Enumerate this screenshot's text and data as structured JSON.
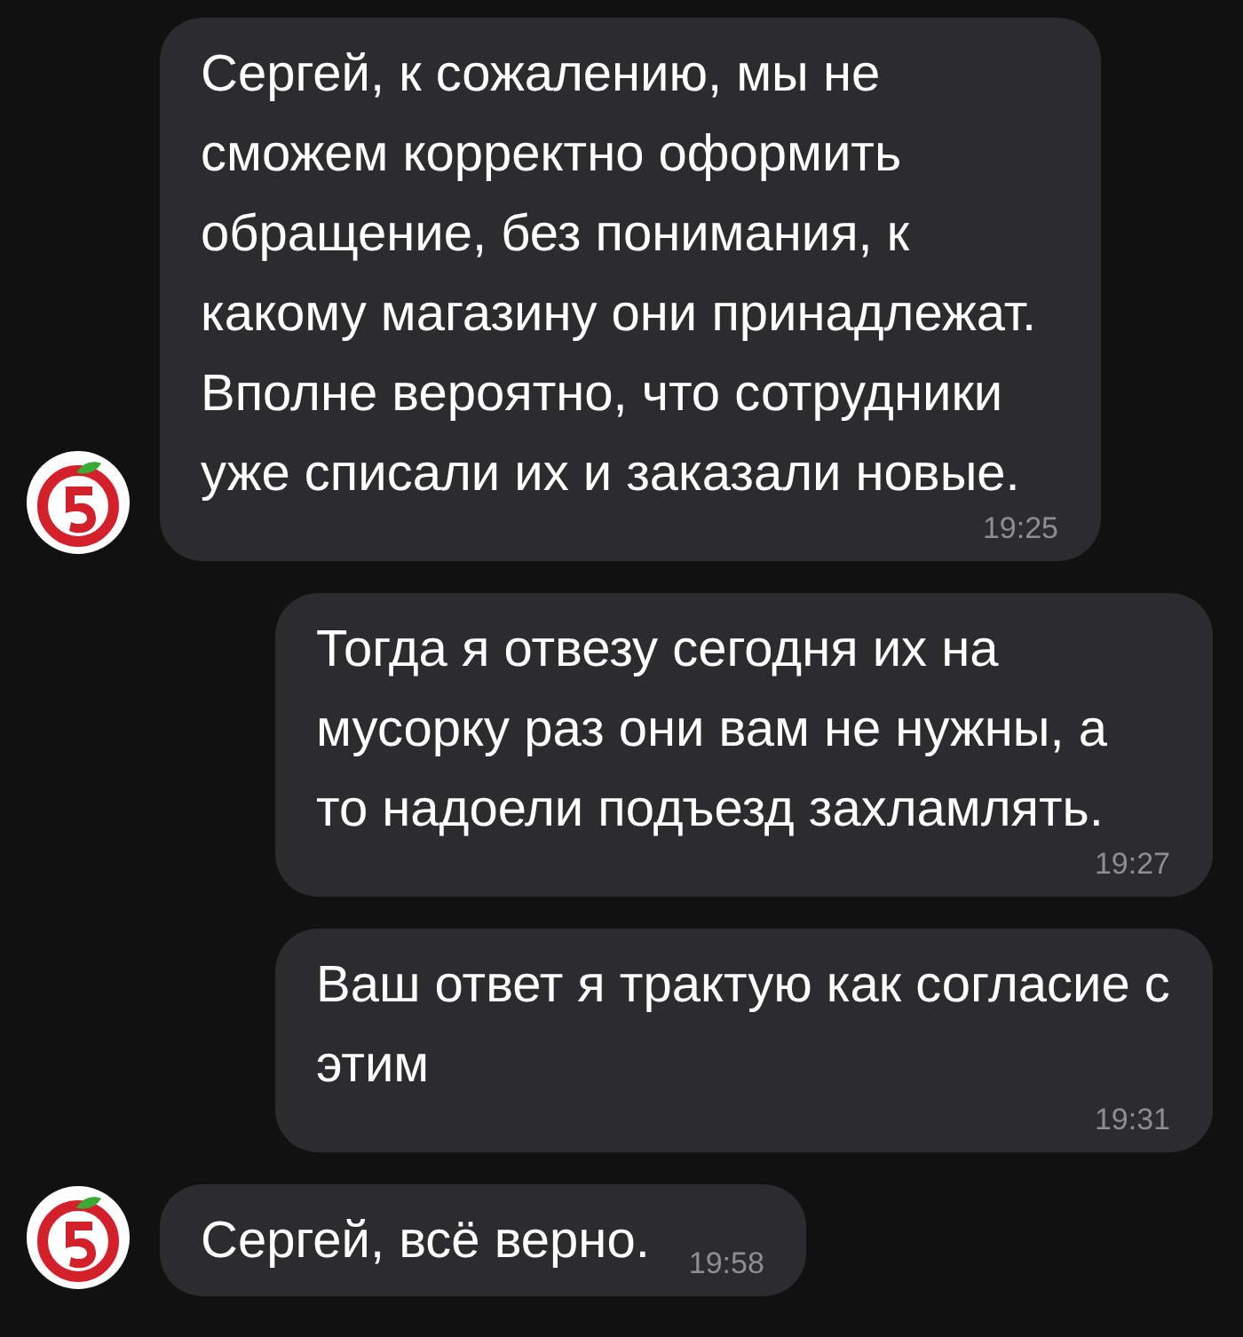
{
  "messages": [
    {
      "kind": "incoming",
      "text": "Сергей, к сожалению, мы не сможем корректно оформить обращение, без понимания, к какому магазину они принадлежат. Вполне вероятно, что сотрудники уже списали их и заказали новые.",
      "time": "19:25"
    },
    {
      "kind": "outgoing",
      "text": "Тогда я отвезу сегодня их на мусорку раз они вам не нужны, а то надоели подъезд захламлять.",
      "time": "19:27"
    },
    {
      "kind": "outgoing",
      "text": "Ваш ответ я трактую как согласие с этим",
      "time": "19:31"
    },
    {
      "kind": "incoming",
      "text": "Сергей, всё верно.",
      "time": "19:58"
    }
  ]
}
